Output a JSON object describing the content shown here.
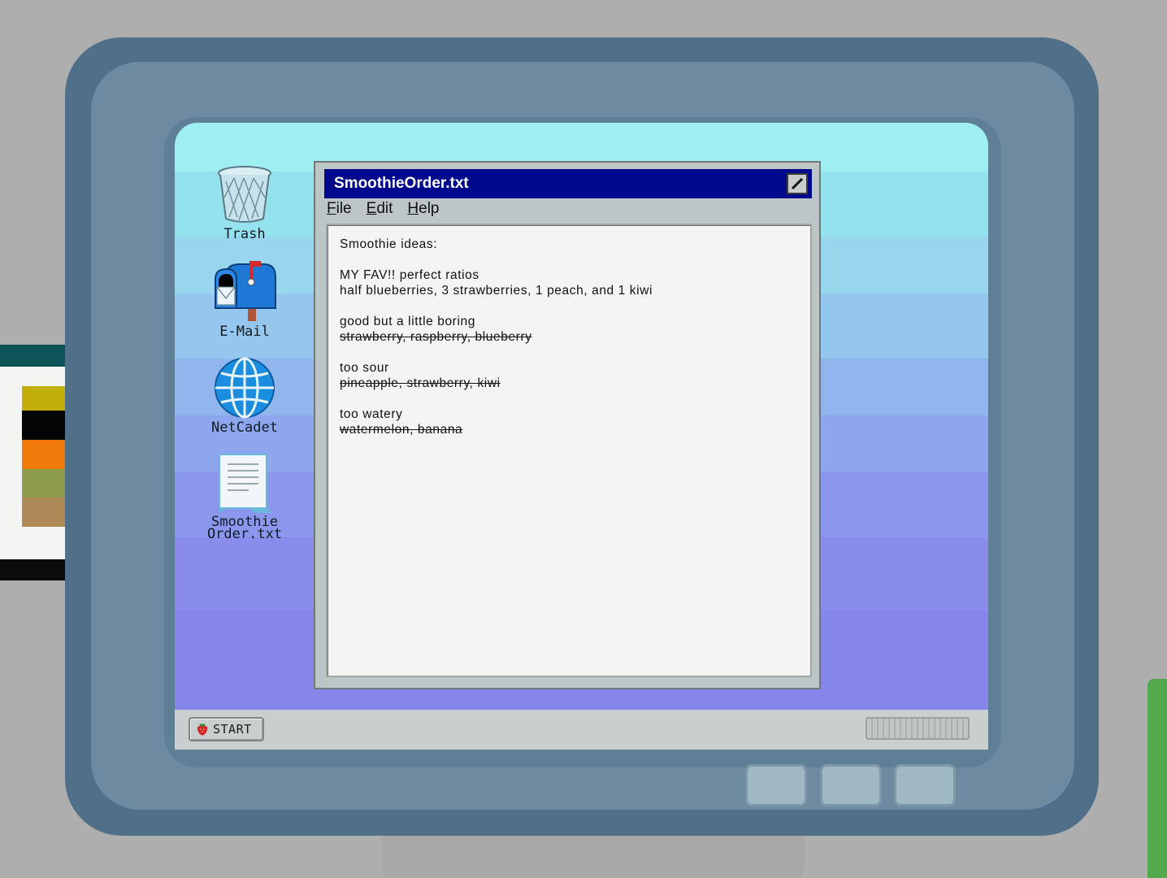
{
  "desktop_icons": [
    {
      "label": "Trash",
      "icon": "trash-icon"
    },
    {
      "label": "E-Mail",
      "icon": "mailbox-icon"
    },
    {
      "label": "NetCadet",
      "icon": "globe-icon"
    },
    {
      "label": "Smoothie",
      "label2": "Order.txt",
      "icon": "document-icon"
    }
  ],
  "window": {
    "title": "SmoothieOrder.txt",
    "menu": [
      {
        "first": "F",
        "rest": "ile"
      },
      {
        "first": "E",
        "rest": "dit"
      },
      {
        "first": "H",
        "rest": "elp"
      }
    ],
    "lines": [
      {
        "text": "Smoothie ideas:",
        "struck": false
      },
      {
        "text": "",
        "struck": false
      },
      {
        "text": "MY FAV!! perfect ratios",
        "struck": false
      },
      {
        "text": "half blueberries, 3 strawberries, 1 peach, and 1 kiwi",
        "struck": false
      },
      {
        "text": "",
        "struck": false
      },
      {
        "text": "good but a little boring",
        "struck": false
      },
      {
        "text": "strawberry, raspberry, blueberry",
        "struck": true
      },
      {
        "text": "",
        "struck": false
      },
      {
        "text": "too sour",
        "struck": false
      },
      {
        "text": "pineapple, strawberry, kiwi",
        "struck": true
      },
      {
        "text": "",
        "struck": false
      },
      {
        "text": "too watery",
        "struck": false
      },
      {
        "text": "watermelon, banana",
        "struck": true
      }
    ]
  },
  "taskbar": {
    "start_label": "START",
    "start_icon": "strawberry-icon"
  },
  "colors": {
    "titlebar": "#01098c",
    "monitor": "#4f7088",
    "swatches": [
      "#c2ae0a",
      "#050505",
      "#f07b0a",
      "#8c9b4c",
      "#ad8a56"
    ]
  }
}
